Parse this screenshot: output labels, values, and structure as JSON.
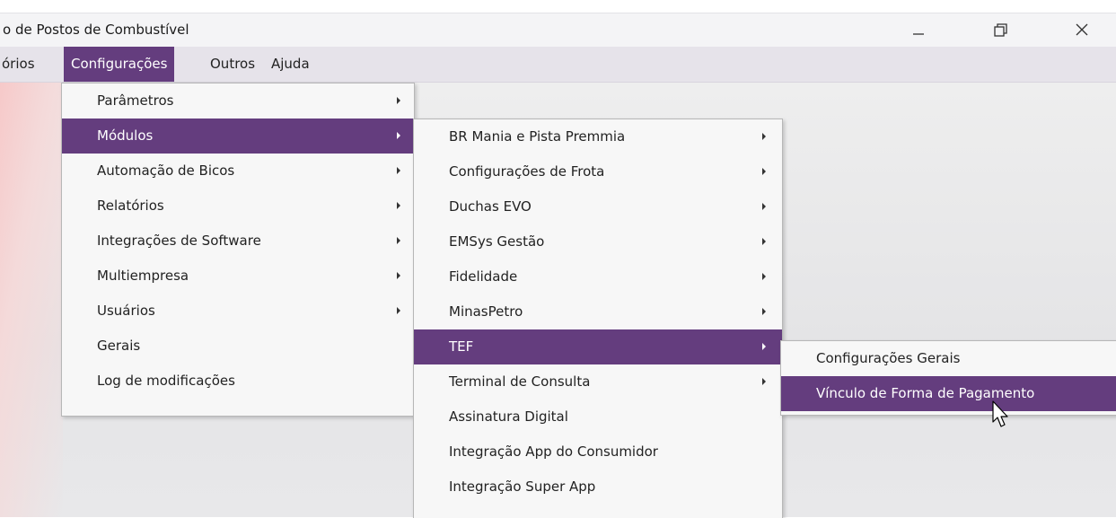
{
  "window": {
    "title": "o de Postos de Combustível",
    "minimize_glyph": "—",
    "maximize_icon": "restore-icon",
    "close_icon": "close-icon"
  },
  "menubar": {
    "items": [
      {
        "label": "órios"
      },
      {
        "label": "Configurações",
        "active": true
      },
      {
        "label": "Outros"
      },
      {
        "label": "Ajuda"
      }
    ]
  },
  "config_menu": {
    "items": [
      {
        "label": "Parâmetros",
        "submenu": true
      },
      {
        "label": "Módulos",
        "submenu": true,
        "highlighted": true
      },
      {
        "label": "Automação de Bicos",
        "submenu": true
      },
      {
        "label": "Relatórios",
        "submenu": true
      },
      {
        "label": "Integrações de Software",
        "submenu": true
      },
      {
        "label": "Multiempresa",
        "submenu": true
      },
      {
        "label": "Usuários",
        "submenu": true
      },
      {
        "label": "Gerais",
        "submenu": false
      },
      {
        "label": "Log de modificações",
        "submenu": false
      }
    ]
  },
  "modulos_menu": {
    "items": [
      {
        "label": "BR Mania e Pista Premmia",
        "submenu": true
      },
      {
        "label": "Configurações de Frota",
        "submenu": true
      },
      {
        "label": "Duchas EVO",
        "submenu": true
      },
      {
        "label": "EMSys Gestão",
        "submenu": true
      },
      {
        "label": "Fidelidade",
        "submenu": true
      },
      {
        "label": "MinasPetro",
        "submenu": true
      },
      {
        "label": "TEF",
        "submenu": true,
        "highlighted": true
      },
      {
        "label": "Terminal de Consulta",
        "submenu": true
      },
      {
        "label": "Assinatura Digital",
        "submenu": false
      },
      {
        "label": "Integração App do Consumidor",
        "submenu": false
      },
      {
        "label": "Integração Super App",
        "submenu": false
      }
    ]
  },
  "tef_menu": {
    "items": [
      {
        "label": "Configurações Gerais"
      },
      {
        "label": "Vínculo de Forma de Pagamento",
        "highlighted": true
      }
    ]
  },
  "colors": {
    "accent": "#643d7e",
    "menu_bg": "#f7f7f7",
    "menubar_bg": "#e6e3ea"
  }
}
